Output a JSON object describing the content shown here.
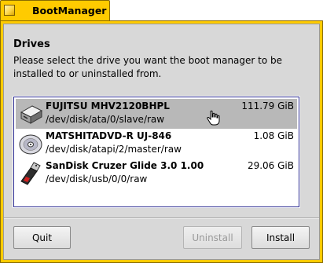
{
  "window": {
    "title": "BootManager",
    "accent_color": "#ffcb00"
  },
  "drives_section": {
    "title": "Drives",
    "description": "Please select the drive you want the boot manager to be installed to or uninstalled from."
  },
  "drives": [
    {
      "name": "FUJITSU MHV2120BHPL",
      "path": "/dev/disk/ata/0/slave/raw",
      "size": "111.79 GiB",
      "icon": "hard-drive-icon",
      "selected": true
    },
    {
      "name": "MATSHITADVD-R   UJ-846",
      "path": "/dev/disk/atapi/2/master/raw",
      "size": "1.08 GiB",
      "icon": "optical-disc-icon",
      "selected": false
    },
    {
      "name": "SanDisk Cruzer Glide 3.0 1.00",
      "path": "/dev/disk/usb/0/0/raw",
      "size": "29.06 GiB",
      "icon": "usb-drive-icon",
      "selected": false
    }
  ],
  "buttons": {
    "quit": "Quit",
    "uninstall": "Uninstall",
    "install": "Install"
  }
}
